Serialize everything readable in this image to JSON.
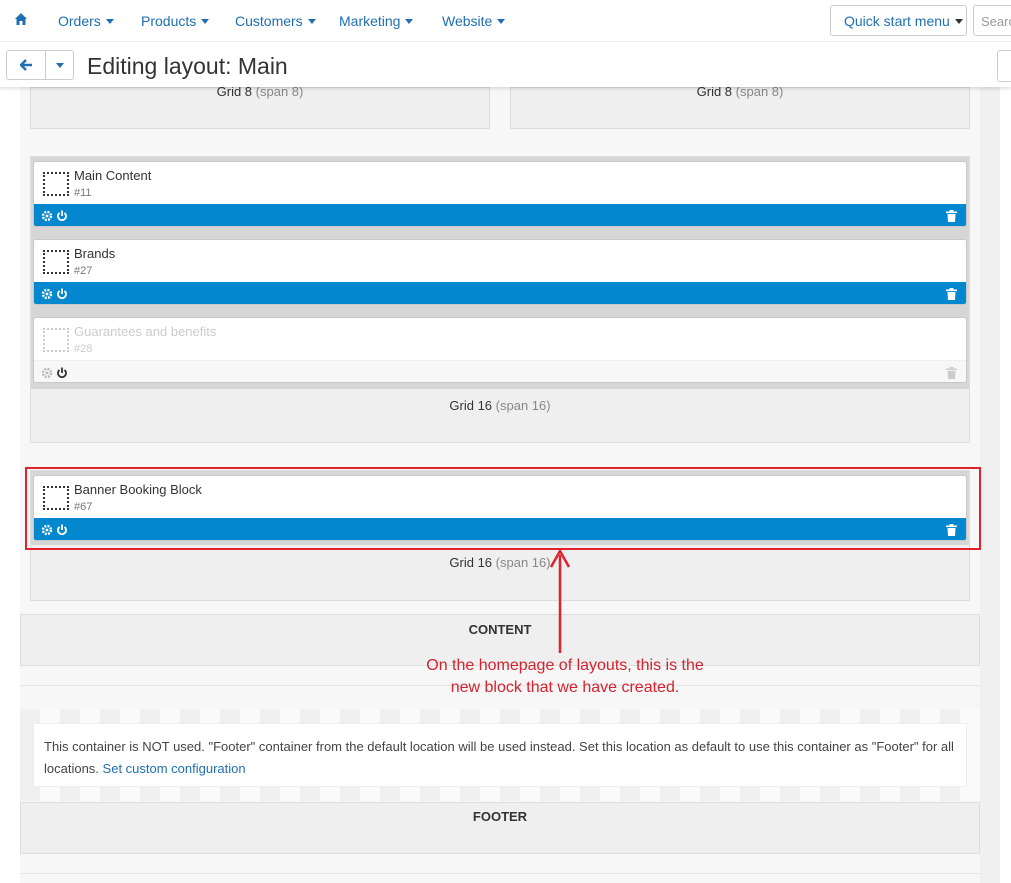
{
  "topnav": {
    "items": [
      {
        "label": "Orders"
      },
      {
        "label": "Products"
      },
      {
        "label": "Customers"
      },
      {
        "label": "Marketing"
      },
      {
        "label": "Website"
      }
    ],
    "quick_start": "Quick start menu",
    "search_placeholder": "Search"
  },
  "header": {
    "title": "Editing layout: Main"
  },
  "grids": {
    "top_left": {
      "name": "Grid 8",
      "span": "(span 8)"
    },
    "top_right": {
      "name": "Grid 8",
      "span": "(span 8)"
    },
    "middle": {
      "name": "Grid 16",
      "span": "(span 16)"
    },
    "banner": {
      "name": "Grid 16",
      "span": "(span 16)"
    }
  },
  "blocks": [
    {
      "name": "Main Content",
      "id": "#11",
      "enabled": true
    },
    {
      "name": "Brands",
      "id": "#27",
      "enabled": true
    },
    {
      "name": "Guarantees and benefits",
      "id": "#28",
      "enabled": false
    },
    {
      "name": "Banner Booking Block",
      "id": "#67",
      "enabled": true
    }
  ],
  "sections": {
    "content": "CONTENT",
    "footer": "FOOTER"
  },
  "footer_notice": {
    "text": "This container is NOT used. \"Footer\" container from the default location will be used instead. Set this location as default to use this container as \"Footer\" for all locations.",
    "link": "Set custom configuration"
  },
  "annotation": {
    "line1": "On the homepage of layouts, this is the",
    "line2": "new block that we have created."
  },
  "colors": {
    "accent": "#0387cf",
    "link": "#1f6fb2",
    "annotation": "#e0222d"
  }
}
